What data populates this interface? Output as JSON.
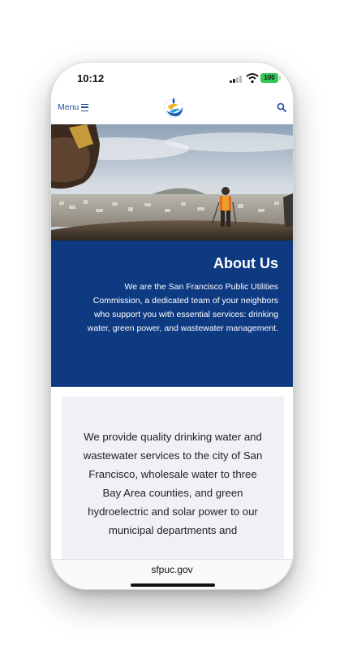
{
  "status_bar": {
    "time": "10:12",
    "battery": "100"
  },
  "nav": {
    "menu_label": "Menu"
  },
  "about": {
    "title": "About Us",
    "description": "We are the San Francisco Public Utilities Commission, a dedicated team of your neighbors who support you with essential services: drinking water, green power, and wastewater management."
  },
  "content": {
    "paragraph": "We provide quality drinking water and wastewater services to the city of San Francisco, wholesale water to three Bay Area counties, and green hydroelectric and solar power to our municipal departments and"
  },
  "browser": {
    "url": "sfpuc.gov"
  },
  "colors": {
    "brand_blue": "#0e3a82",
    "link_blue": "#1f4da1",
    "card_bg": "#f0f1f7"
  },
  "icons": [
    "menu-icon",
    "search-icon",
    "sfpuc-logo",
    "signal-icon",
    "wifi-icon",
    "battery-icon"
  ]
}
